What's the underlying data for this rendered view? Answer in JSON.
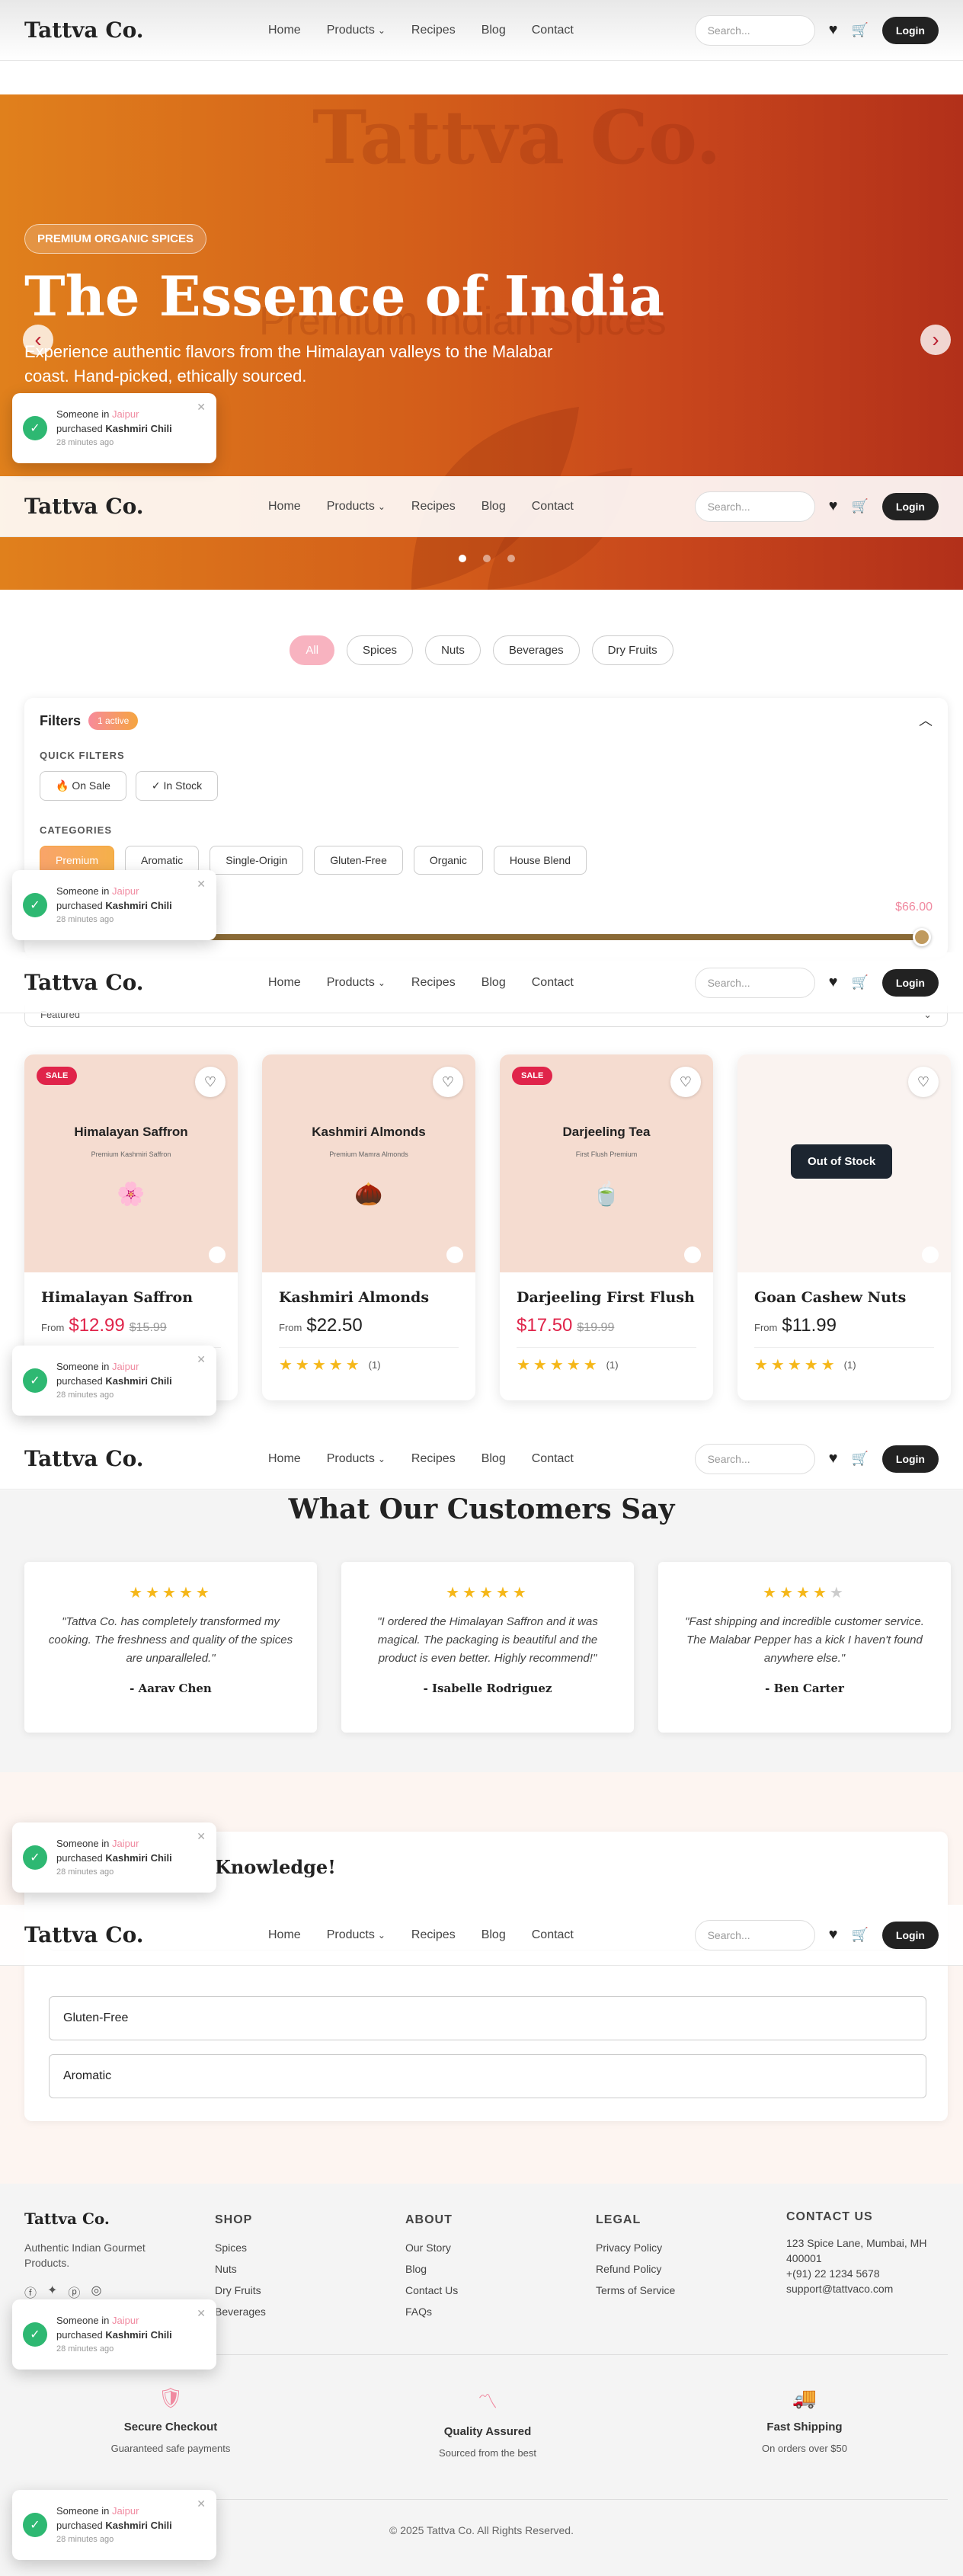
{
  "brand": "Tattva Co.",
  "nav": {
    "home": "Home",
    "products": "Products",
    "recipes": "Recipes",
    "blog": "Blog",
    "contact": "Contact"
  },
  "search_placeholder": "Search...",
  "login_label": "Login",
  "hero": {
    "badge": "PREMIUM ORGANIC SPICES",
    "title": "The Essence of India",
    "subtitle": "Experience authentic flavors from the Himalayan valleys to the Malabar coast. Hand-picked, ethically sourced.",
    "watermark_title": "Tattva Co.",
    "watermark_sub": "Premium Indian Spices"
  },
  "toast": {
    "prefix": "Someone in",
    "city": "Jaipur",
    "action": "purchased",
    "product": "Kashmiri Chili",
    "time": "28 minutes ago"
  },
  "category_tabs": [
    "All",
    "Spices",
    "Nuts",
    "Beverages",
    "Dry Fruits"
  ],
  "filters": {
    "title": "Filters",
    "active_badge": "1 active",
    "quick_label": "QUICK FILTERS",
    "quick": [
      "🔥 On Sale",
      "✓ In Stock"
    ],
    "categories_label": "CATEGORIES",
    "categories": [
      "Premium",
      "Aromatic",
      "Single-Origin",
      "Gluten-Free",
      "Organic",
      "House Blend"
    ],
    "price_max": "$66.00",
    "sort": "Featured"
  },
  "products": [
    {
      "name": "Himalayan Saffron",
      "img_title": "Himalayan Saffron",
      "img_sub": "Premium Kashmiri Saffron",
      "sale": "SALE",
      "from": "From",
      "price": "$12.99",
      "old_price": "$15.99",
      "rating_count": "(1)"
    },
    {
      "name": "Kashmiri Almonds",
      "img_title": "Kashmiri Almonds",
      "img_sub": "Premium Mamra Almonds",
      "sale": "",
      "from": "From",
      "price": "$22.50",
      "old_price": "",
      "rating_count": "(1)"
    },
    {
      "name": "Darjeeling First Flush ...",
      "img_title": "Darjeeling Tea",
      "img_sub": "First Flush Premium",
      "sale": "SALE",
      "from": "",
      "price": "$17.50",
      "old_price": "$19.99",
      "rating_count": "(1)"
    },
    {
      "name": "Goan Cashew Nuts",
      "img_title": "",
      "img_sub": "",
      "sale": "",
      "from": "From",
      "price": "$11.99",
      "old_price": "",
      "rating_count": "(1)",
      "overlay": "Out of Stock"
    }
  ],
  "testimonials": {
    "title": "What Our Customers Say",
    "items": [
      {
        "quote": "\"Tattva Co. has completely transformed my cooking. The freshness and quality of the spices are unparalleled.\"",
        "author": "- Aarav Chen",
        "rating": 5
      },
      {
        "quote": "\"I ordered the Himalayan Saffron and it was magical. The packaging is beautiful and the product is even better. Highly recommend!\"",
        "author": "- Isabelle Rodriguez",
        "rating": 5
      },
      {
        "quote": "\"Fast shipping and incredible customer service. The Malabar Pepper has a kick I haven't found anywhere else.\"",
        "author": "- Ben Carter",
        "rating": 4
      }
    ]
  },
  "quiz": {
    "title": "Knowledge!",
    "options": [
      "Gluten-Free",
      "Aromatic"
    ]
  },
  "footer": {
    "tagline": "Authentic Indian Gourmet Products.",
    "shop": {
      "title": "SHOP",
      "links": [
        "Spices",
        "Nuts",
        "Dry Fruits",
        "Beverages"
      ]
    },
    "about": {
      "title": "ABOUT",
      "links": [
        "Our Story",
        "Blog",
        "Contact Us",
        "FAQs"
      ]
    },
    "legal": {
      "title": "LEGAL",
      "links": [
        "Privacy Policy",
        "Refund Policy",
        "Terms of Service"
      ]
    },
    "contact": {
      "title": "CONTACT US",
      "lines": [
        "123 Spice Lane, Mumbai, MH 400001",
        "+(91) 22 1234 5678",
        "support@tattvaco.com"
      ]
    },
    "features": [
      {
        "title": "Secure Checkout",
        "sub": "Guaranteed safe payments"
      },
      {
        "title": "Quality Assured",
        "sub": "Sourced from the best"
      },
      {
        "title": "Fast Shipping",
        "sub": "On orders over $50"
      }
    ],
    "copyright": "© 2025 Tattva Co. All Rights Reserved."
  },
  "colors": {
    "accent": "#e0801c",
    "sale": "#e0244a",
    "dark": "#222222",
    "success": "#2eb872"
  }
}
